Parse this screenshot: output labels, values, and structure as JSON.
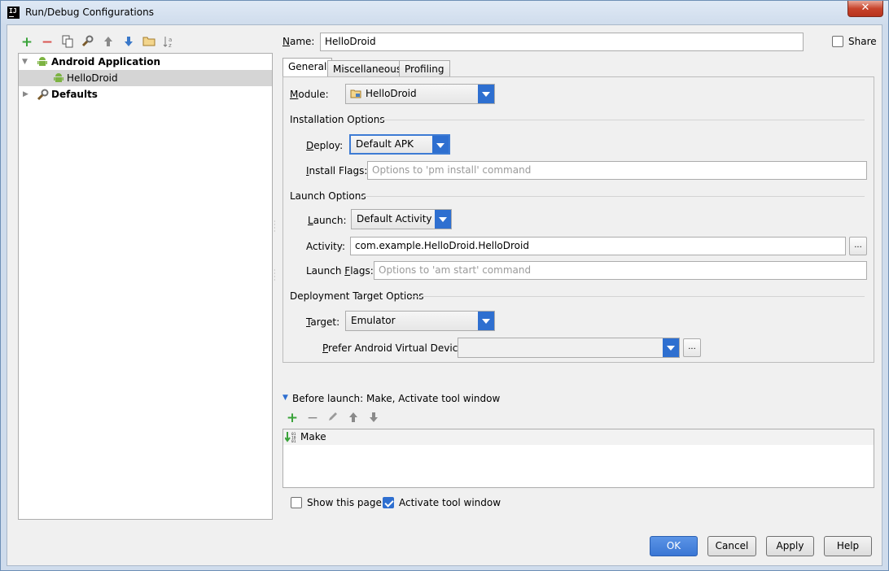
{
  "window": {
    "title": "Run/Debug Configurations",
    "app_icon_text": "IJ",
    "close_symbol": "✕"
  },
  "toolbar": {
    "icons": [
      "add-icon",
      "remove-icon",
      "copy-icon",
      "edit-defaults-icon",
      "move-up-icon",
      "move-down-icon",
      "folder-icon",
      "sort-icon"
    ],
    "add": "+",
    "remove": "−"
  },
  "tree": {
    "items": [
      {
        "label": "Android Application",
        "expanded": true,
        "bold": true
      },
      {
        "label": "HelloDroid",
        "selected": true
      },
      {
        "label": "Defaults",
        "expanded": false,
        "bold": true
      }
    ]
  },
  "name_row": {
    "label": "Name:",
    "value": "HelloDroid",
    "share_label": "Share",
    "share_checked": false
  },
  "tabs": [
    {
      "label": "General",
      "active": true
    },
    {
      "label": "Miscellaneous",
      "active": false
    },
    {
      "label": "Profiling",
      "active": false
    }
  ],
  "general": {
    "module_label": "Module:",
    "module_value": "HelloDroid",
    "installation_title": "Installation Options",
    "deploy_label": "Deploy:",
    "deploy_value": "Default APK",
    "install_flags_label": "Install Flags:",
    "install_flags_placeholder": "Options to 'pm install' command",
    "launch_title": "Launch Options",
    "launch_label": "Launch:",
    "launch_value": "Default Activity",
    "activity_label": "Activity:",
    "activity_value": "com.example.HelloDroid.HelloDroid",
    "launch_flags_label": "Launch Flags:",
    "launch_flags_placeholder": "Options to 'am start' command",
    "deployment_title": "Deployment Target Options",
    "target_label": "Target:",
    "target_value": "Emulator",
    "prefer_avd_label": "Prefer Android Virtual Device:",
    "prefer_avd_value": "",
    "ellipsis": "..."
  },
  "before_launch": {
    "title": "Before launch: Make, Activate tool window",
    "items": [
      {
        "label": "Make",
        "icon": "make-icon"
      }
    ],
    "tool_icons": [
      "add-icon",
      "remove-icon",
      "edit-icon",
      "move-up-icon",
      "move-down-icon"
    ]
  },
  "options": {
    "show_page_label": "Show this page",
    "show_page_checked": false,
    "activate_label": "Activate tool window",
    "activate_checked": true
  },
  "buttons": {
    "ok": "OK",
    "cancel": "Cancel",
    "apply": "Apply",
    "help": "Help"
  },
  "colors": {
    "accent": "#2e6fd0",
    "android_green": "#7cb342",
    "add_green": "#3aa33a",
    "remove_red": "#d9534f"
  }
}
